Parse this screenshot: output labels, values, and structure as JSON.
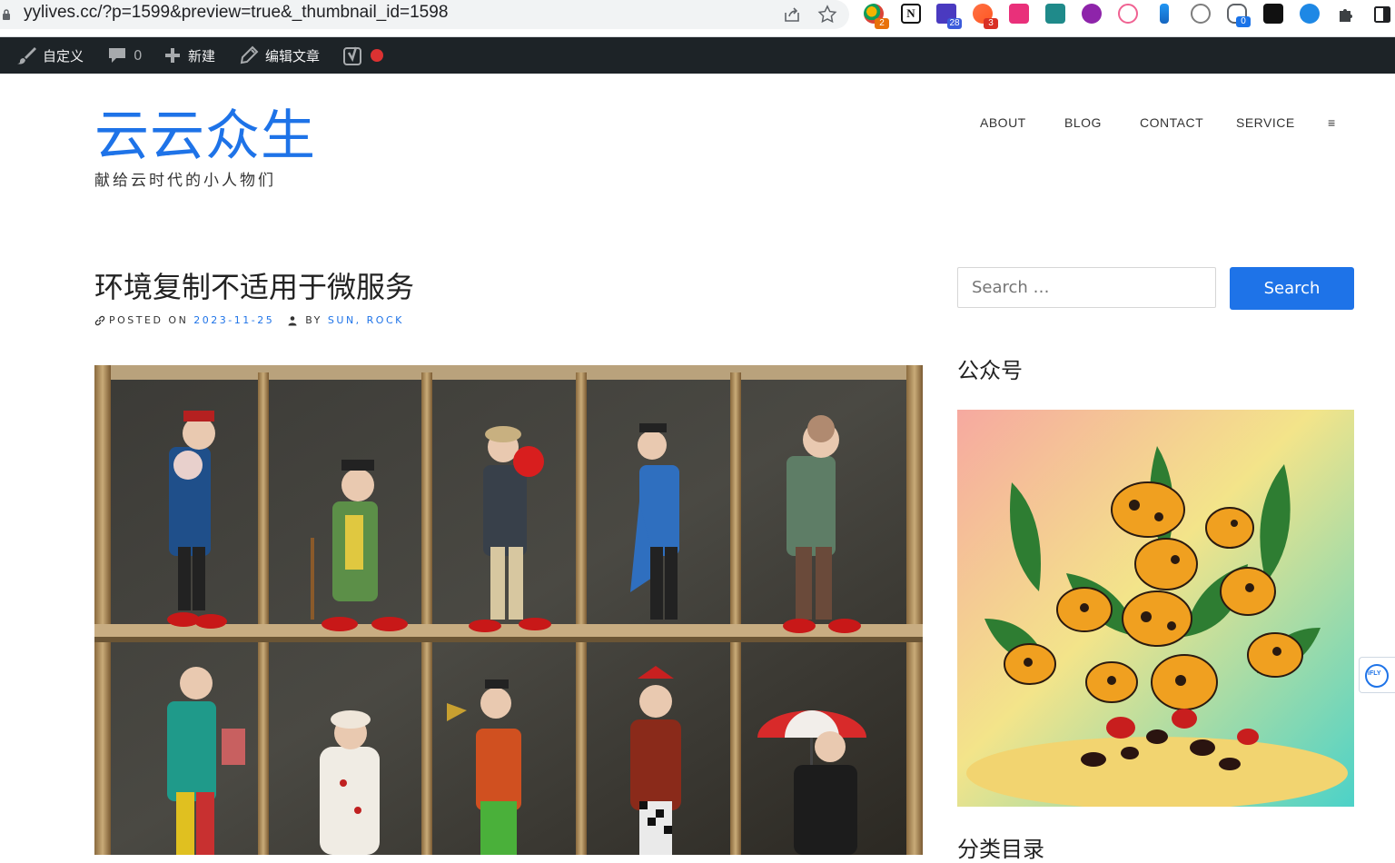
{
  "browser": {
    "url": "yylives.cc/?p=1599&preview=true&_thumbnail_id=1598",
    "extensions": [
      {
        "name": "ext-1",
        "badge": "2",
        "badge_color": "#e8710a"
      },
      {
        "name": "notion",
        "badge": "",
        "badge_color": ""
      },
      {
        "name": "ext-3",
        "badge": "28",
        "badge_color": "#3b5bdb"
      },
      {
        "name": "ext-4",
        "badge": "3",
        "badge_color": "#d93025"
      },
      {
        "name": "ext-5",
        "badge": "",
        "badge_color": ""
      },
      {
        "name": "ext-6",
        "badge": "",
        "badge_color": ""
      },
      {
        "name": "ext-7",
        "badge": "",
        "badge_color": ""
      },
      {
        "name": "ext-8",
        "badge": "",
        "badge_color": ""
      },
      {
        "name": "ext-9",
        "badge": "",
        "badge_color": ""
      },
      {
        "name": "openai",
        "badge": "",
        "badge_color": ""
      },
      {
        "name": "ext-11",
        "badge": "0",
        "badge_color": "#1a73e8"
      },
      {
        "name": "ext-12",
        "badge": "",
        "badge_color": ""
      },
      {
        "name": "ext-13",
        "badge": "",
        "badge_color": ""
      }
    ]
  },
  "adminbar": {
    "customize": "自定义",
    "comments_count": "0",
    "new": "新建",
    "edit_post": "编辑文章"
  },
  "site": {
    "title": "云云众生",
    "description": "献给云时代的小人物们"
  },
  "nav": {
    "items": [
      "ABOUT",
      "BLOG",
      "CONTACT",
      "SERVICE"
    ],
    "menu_toggle": "≡"
  },
  "post": {
    "title": "环境复制不适用于微服务",
    "posted_on_label": "POSTED ON",
    "date": "2023-11-25",
    "by_label": "BY",
    "authors": "SUN, ROCK"
  },
  "sidebar": {
    "search_placeholder": "Search …",
    "search_button": "Search",
    "widget1_title": "公众号",
    "widget2_title": "分类目录"
  },
  "ifly": "iFLY",
  "colors": {
    "accent": "#1e73e8",
    "adminbar_bg": "#1d2327"
  }
}
